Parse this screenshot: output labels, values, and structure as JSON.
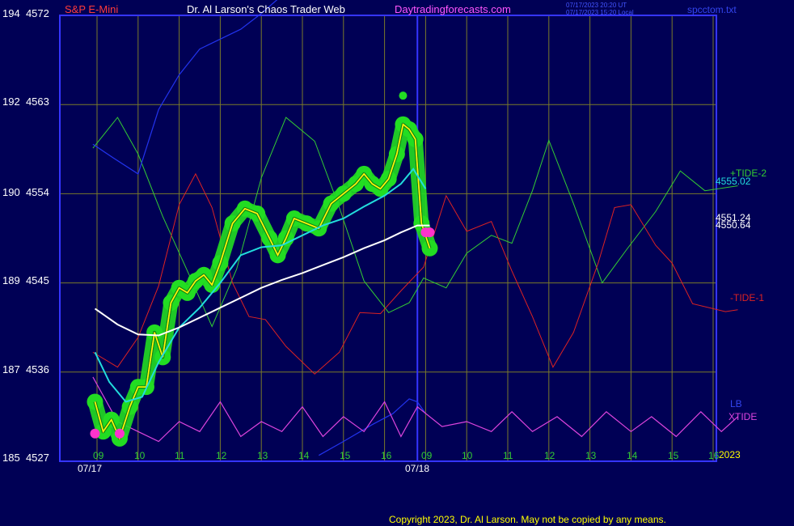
{
  "header": {
    "symbol": "S&P E-Mini",
    "author": "Dr. Al Larson's Chaos Trader Web",
    "site": "Daytradingforecasts.com",
    "timestamp_ut": "07/17/2023 20:20 UT",
    "timestamp_local": "07/17/2023 15:20 Local",
    "filename": "spcctom.txt"
  },
  "footer": {
    "copyright": "Copyright 2023, Dr. Al Larson. May not be copied by any means.",
    "year": "2023"
  },
  "colors": {
    "background": "#000055",
    "frame": "#3535ff",
    "grid": "#7a7a2a",
    "tide1": "#dd2222",
    "tide2": "#33cc33",
    "lb": "#2233ee",
    "xtide": "#dd44dd",
    "price_band": "#22dd22",
    "price_line": "#ffff00",
    "ma_fast": "#22dddd",
    "ma_slow": "#ffffff",
    "dots": "#ff33cc"
  },
  "chart_data": {
    "type": "line",
    "y_axis": {
      "labels": [
        {
          "left": "194",
          "right": "4572"
        },
        {
          "left": "192",
          "right": "4563"
        },
        {
          "left": "190",
          "right": "4554"
        },
        {
          "left": "189",
          "right": "4545"
        },
        {
          "left": "187",
          "right": "4536"
        },
        {
          "left": "185",
          "right": "4527"
        }
      ],
      "ylim": [
        4527,
        4572
      ]
    },
    "x_axis": {
      "hour_ticks": [
        "09",
        "10",
        "11",
        "12",
        "13",
        "14",
        "15",
        "16",
        "09",
        "10",
        "11",
        "12",
        "13",
        "14",
        "15",
        "16"
      ],
      "date_labels": [
        "07/17",
        "07/18"
      ],
      "now_divider_index": 7.8
    },
    "levels": {
      "tide2_label": "+TIDE-2",
      "tide2_value": "4555.02",
      "close_value_1": "4551.24",
      "close_value_2": "4550.64",
      "tide1_label": "-TIDE-1",
      "lb_label": "LB",
      "xtide_label": "XTIDE"
    },
    "series": [
      {
        "name": "+TIDE-2",
        "values": [
          [
            -0.1,
            4558.6
          ],
          [
            0.5,
            4561.7
          ],
          [
            1.0,
            4558.0
          ],
          [
            1.6,
            4551.7
          ],
          [
            2.3,
            4545.3
          ],
          [
            2.8,
            4540.6
          ],
          [
            3.4,
            4546.4
          ],
          [
            4.0,
            4555.6
          ],
          [
            4.6,
            4561.7
          ],
          [
            5.3,
            4559.3
          ],
          [
            5.9,
            4552.6
          ],
          [
            6.5,
            4545.2
          ],
          [
            7.1,
            4542.0
          ],
          [
            7.6,
            4543.0
          ],
          [
            7.95,
            4545.5
          ],
          [
            8.5,
            4544.5
          ],
          [
            9.0,
            4548.0
          ],
          [
            9.6,
            4549.8
          ],
          [
            10.1,
            4549.0
          ],
          [
            10.6,
            4554.3
          ],
          [
            11.0,
            4559.4
          ],
          [
            11.6,
            4553.0
          ],
          [
            12.3,
            4545.0
          ],
          [
            12.9,
            4548.4
          ],
          [
            13.6,
            4552.2
          ],
          [
            14.2,
            4556.3
          ],
          [
            14.8,
            4554.3
          ],
          [
            15.6,
            4554.8
          ]
        ]
      },
      {
        "name": "-TIDE-1",
        "values": [
          [
            -0.1,
            4538.0
          ],
          [
            0.5,
            4536.5
          ],
          [
            1.0,
            4539.5
          ],
          [
            1.5,
            4544.7
          ],
          [
            2.0,
            4552.9
          ],
          [
            2.4,
            4556.0
          ],
          [
            2.8,
            4552.6
          ],
          [
            3.3,
            4545.0
          ],
          [
            3.7,
            4541.6
          ],
          [
            4.1,
            4541.3
          ],
          [
            4.6,
            4538.6
          ],
          [
            5.3,
            4535.8
          ],
          [
            5.9,
            4538.0
          ],
          [
            6.4,
            4542.0
          ],
          [
            6.9,
            4541.9
          ],
          [
            7.4,
            4544.2
          ],
          [
            7.95,
            4546.6
          ],
          [
            8.5,
            4553.8
          ],
          [
            9.0,
            4550.2
          ],
          [
            9.6,
            4551.2
          ],
          [
            10.1,
            4546.2
          ],
          [
            10.6,
            4541.6
          ],
          [
            11.1,
            4536.5
          ],
          [
            11.6,
            4540.0
          ],
          [
            12.2,
            4547.0
          ],
          [
            12.6,
            4552.6
          ],
          [
            13.0,
            4552.9
          ],
          [
            13.6,
            4548.8
          ],
          [
            14.0,
            4547.0
          ],
          [
            14.5,
            4542.9
          ],
          [
            15.3,
            4542.1
          ],
          [
            15.6,
            4542.3
          ]
        ]
      },
      {
        "name": "LB",
        "values": [
          [
            -0.1,
            4559.0
          ],
          [
            0.4,
            4557.6
          ],
          [
            1.0,
            4556.0
          ],
          [
            1.5,
            4562.5
          ],
          [
            2.0,
            4566.0
          ],
          [
            2.5,
            4568.6
          ],
          [
            3.5,
            4570.6
          ],
          [
            4.0,
            4572.2
          ],
          [
            4.5,
            4574.0
          ]
        ],
        "extra": [
          [
            5.4,
            4527.6
          ],
          [
            6.0,
            4529.0
          ],
          [
            6.7,
            4530.7
          ],
          [
            7.2,
            4531.8
          ],
          [
            7.6,
            4533.3
          ],
          [
            7.8,
            4533.0
          ],
          [
            8.0,
            4531.8
          ]
        ]
      },
      {
        "name": "XTIDE",
        "values": [
          [
            -0.1,
            4535.5
          ],
          [
            0.5,
            4531.0
          ],
          [
            1.0,
            4530.0
          ],
          [
            1.5,
            4529.0
          ],
          [
            2.0,
            4531.0
          ],
          [
            2.5,
            4530.0
          ],
          [
            3.0,
            4533.0
          ],
          [
            3.5,
            4529.5
          ],
          [
            4.0,
            4531.0
          ],
          [
            4.5,
            4530.0
          ],
          [
            5.0,
            4532.5
          ],
          [
            5.5,
            4529.5
          ],
          [
            6.0,
            4531.5
          ],
          [
            6.5,
            4530.0
          ],
          [
            7.0,
            4533.0
          ],
          [
            7.4,
            4529.5
          ],
          [
            7.8,
            4532.5
          ],
          [
            8.4,
            4530.5
          ],
          [
            9.0,
            4531.0
          ],
          [
            9.6,
            4530.0
          ],
          [
            10.1,
            4532.0
          ],
          [
            10.6,
            4530.0
          ],
          [
            11.2,
            4531.5
          ],
          [
            11.8,
            4529.5
          ],
          [
            12.4,
            4532.0
          ],
          [
            13.0,
            4530.0
          ],
          [
            13.5,
            4531.5
          ],
          [
            14.1,
            4529.5
          ],
          [
            14.7,
            4532.0
          ],
          [
            15.2,
            4530.0
          ],
          [
            15.6,
            4531.5
          ]
        ]
      },
      {
        "name": "price",
        "values": [
          [
            -0.05,
            4533.0
          ],
          [
            0.15,
            4530.0
          ],
          [
            0.35,
            4531.2
          ],
          [
            0.55,
            4529.3
          ],
          [
            0.8,
            4532.5
          ],
          [
            1.0,
            4534.5
          ],
          [
            1.2,
            4534.5
          ],
          [
            1.4,
            4540.0
          ],
          [
            1.6,
            4537.5
          ],
          [
            1.8,
            4543.0
          ],
          [
            2.0,
            4544.5
          ],
          [
            2.2,
            4544.0
          ],
          [
            2.4,
            4545.2
          ],
          [
            2.6,
            4545.8
          ],
          [
            2.8,
            4544.8
          ],
          [
            3.0,
            4547.0
          ],
          [
            3.3,
            4551.0
          ],
          [
            3.6,
            4552.5
          ],
          [
            3.9,
            4552.0
          ],
          [
            4.2,
            4549.5
          ],
          [
            4.4,
            4547.8
          ],
          [
            4.6,
            4549.5
          ],
          [
            4.8,
            4551.5
          ],
          [
            5.1,
            4551.0
          ],
          [
            5.4,
            4550.5
          ],
          [
            5.7,
            4553.0
          ],
          [
            6.0,
            4554.0
          ],
          [
            6.3,
            4555.0
          ],
          [
            6.5,
            4556.0
          ],
          [
            6.7,
            4555.0
          ],
          [
            6.9,
            4554.5
          ],
          [
            7.1,
            4555.5
          ],
          [
            7.3,
            4558.0
          ],
          [
            7.45,
            4561.0
          ],
          [
            7.6,
            4560.5
          ],
          [
            7.75,
            4559.5
          ],
          [
            7.9,
            4551.0
          ],
          [
            8.1,
            4548.5
          ]
        ]
      },
      {
        "name": "ma_fast",
        "values": [
          [
            -0.05,
            4538.0
          ],
          [
            0.3,
            4535.0
          ],
          [
            0.7,
            4533.0
          ],
          [
            1.1,
            4533.5
          ],
          [
            1.5,
            4537.0
          ],
          [
            2.0,
            4540.5
          ],
          [
            2.5,
            4542.5
          ],
          [
            3.0,
            4545.0
          ],
          [
            3.5,
            4547.8
          ],
          [
            4.0,
            4548.6
          ],
          [
            4.5,
            4548.8
          ],
          [
            5.0,
            4549.8
          ],
          [
            5.5,
            4550.8
          ],
          [
            6.0,
            4551.5
          ],
          [
            6.5,
            4552.7
          ],
          [
            7.0,
            4553.8
          ],
          [
            7.4,
            4555.0
          ],
          [
            7.7,
            4556.5
          ],
          [
            8.0,
            4554.5
          ]
        ]
      },
      {
        "name": "ma_slow",
        "values": [
          [
            -0.05,
            4542.4
          ],
          [
            0.5,
            4540.8
          ],
          [
            1.0,
            4539.8
          ],
          [
            1.5,
            4539.7
          ],
          [
            2.0,
            4540.5
          ],
          [
            2.5,
            4541.5
          ],
          [
            3.0,
            4542.5
          ],
          [
            3.5,
            4543.5
          ],
          [
            4.0,
            4544.5
          ],
          [
            4.5,
            4545.3
          ],
          [
            5.0,
            4546.0
          ],
          [
            5.5,
            4546.8
          ],
          [
            6.0,
            4547.6
          ],
          [
            6.5,
            4548.5
          ],
          [
            7.0,
            4549.3
          ],
          [
            7.4,
            4550.1
          ],
          [
            7.8,
            4550.8
          ],
          [
            8.1,
            4550.8
          ]
        ]
      }
    ],
    "markers": [
      [
        -0.05,
        4529.8
      ],
      [
        0.55,
        4529.8
      ],
      [
        8.0,
        4550.1
      ],
      [
        8.1,
        4550.1
      ]
    ],
    "peak_marker": [
      7.45,
      4563.9
    ],
    "grid": true
  }
}
